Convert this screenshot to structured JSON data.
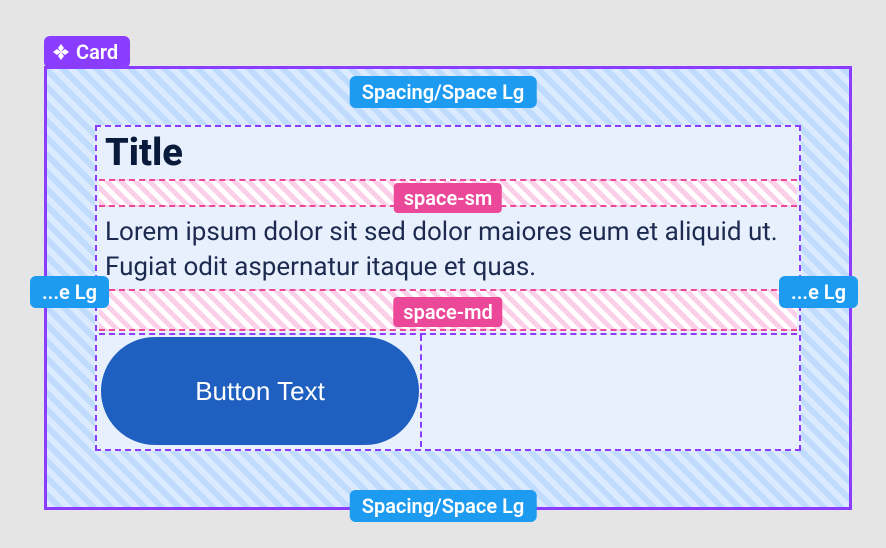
{
  "component": {
    "name": "Card"
  },
  "spacing": {
    "outer_top": "Spacing/Space Lg",
    "outer_bottom": "Spacing/Space Lg",
    "outer_left": "...e Lg",
    "outer_right": "...e Lg",
    "inner_sm": "space-sm",
    "inner_md": "space-md"
  },
  "card": {
    "title": "Title",
    "body": "Lorem ipsum dolor sit sed dolor maiores eum et aliquid ut. Fugiat odit aspernatur itaque et quas.",
    "button_label": "Button Text"
  }
}
